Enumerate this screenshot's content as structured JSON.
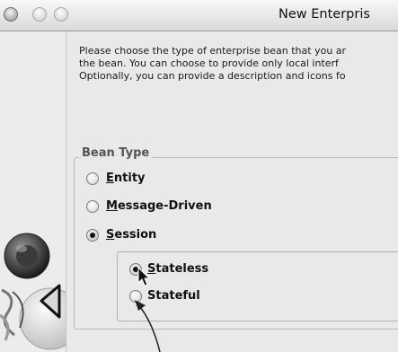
{
  "window": {
    "title": "New Enterpris"
  },
  "description": {
    "lines": [
      "Please choose the type of enterprise bean that you ar",
      "the bean.  You can choose to provide only local interf",
      "Optionally, you can provide a description and icons fo"
    ]
  },
  "bean_type": {
    "legend": "Bean Type",
    "options": [
      {
        "mnemonic": "E",
        "rest": "ntity",
        "selected": false
      },
      {
        "mnemonic": "M",
        "rest": "essage-Driven",
        "selected": false
      },
      {
        "mnemonic": "S",
        "rest": "ession",
        "selected": true
      }
    ]
  },
  "session_type": {
    "options": [
      {
        "mnemonic": "S",
        "rest": "tateless",
        "selected": true
      },
      {
        "mnemonic": "",
        "rest": "Stateful",
        "selected": false
      }
    ]
  },
  "colors": {
    "window_bg": "#e6e6e6",
    "content_bg": "#e9e9e9",
    "legend_text": "#555555",
    "border": "#b9b9b9"
  },
  "icons": [
    "close-button-icon",
    "minimize-button-icon",
    "zoom-button-icon",
    "mouse-pointer-icon"
  ]
}
